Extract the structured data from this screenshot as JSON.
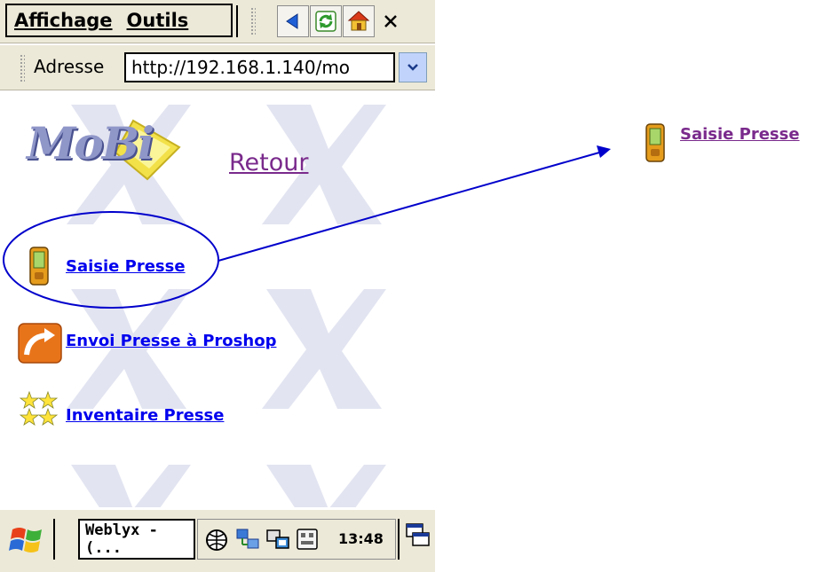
{
  "menu": {
    "display": "Affichage",
    "tools": "Outils"
  },
  "address": {
    "label": "Adresse",
    "url": "http://192.168.1.140/mo"
  },
  "content": {
    "logo_text": "MoBi",
    "back_link": "Retour",
    "links": [
      {
        "label": "Saisie Presse",
        "icon": "handheld-device-icon"
      },
      {
        "label": "Envoi Presse à Proshop",
        "icon": "send-arrow-icon"
      },
      {
        "label": "Inventaire Presse",
        "icon": "stars-icon"
      }
    ]
  },
  "taskbar": {
    "app": "Weblyx - (...",
    "time": "13:48"
  },
  "callout": {
    "label": "Saisie Presse",
    "icon": "handheld-device-icon"
  },
  "colors": {
    "link": "#0000ee",
    "visited": "#7a2a8c",
    "annotation": "#0000cc",
    "chrome": "#ece9d8"
  }
}
